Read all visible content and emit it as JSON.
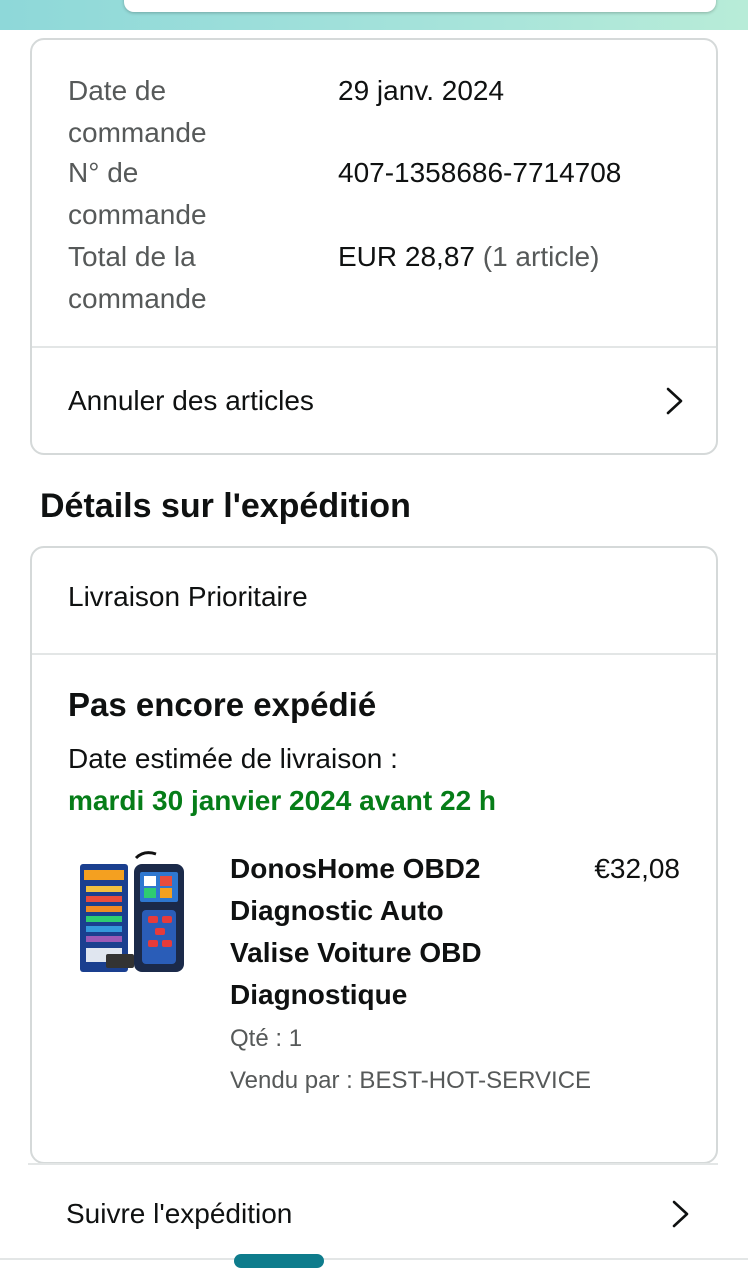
{
  "order": {
    "date_label": "Date de commande",
    "date_value": "29 janv. 2024",
    "number_label": "N° de commande",
    "number_value": "407-1358686-7714708",
    "total_label": "Total de la commande",
    "total_value": "EUR 28,87",
    "total_items": "(1 article)",
    "cancel_label": "Annuler des articles"
  },
  "shipping": {
    "section_title": "Détails sur l'expédition",
    "method": "Livraison Prioritaire",
    "status": "Pas encore expédié",
    "estimate_label": "Date estimée de livraison :",
    "estimate_value": "mardi 30 janvier 2024 avant 22 h",
    "product": {
      "title": "DonosHome OBD2 Diagnostic Auto Valise Voiture OBD Diagnostique",
      "price": "€32,08",
      "quantity": "Qté : 1",
      "seller": "Vendu par : BEST-HOT-SERVICE"
    },
    "track_label": "Suivre l'expédition"
  },
  "icons": {
    "chevron": "chevron-right-icon"
  },
  "colors": {
    "green": "#067d18",
    "accent": "#0e7c8c"
  }
}
